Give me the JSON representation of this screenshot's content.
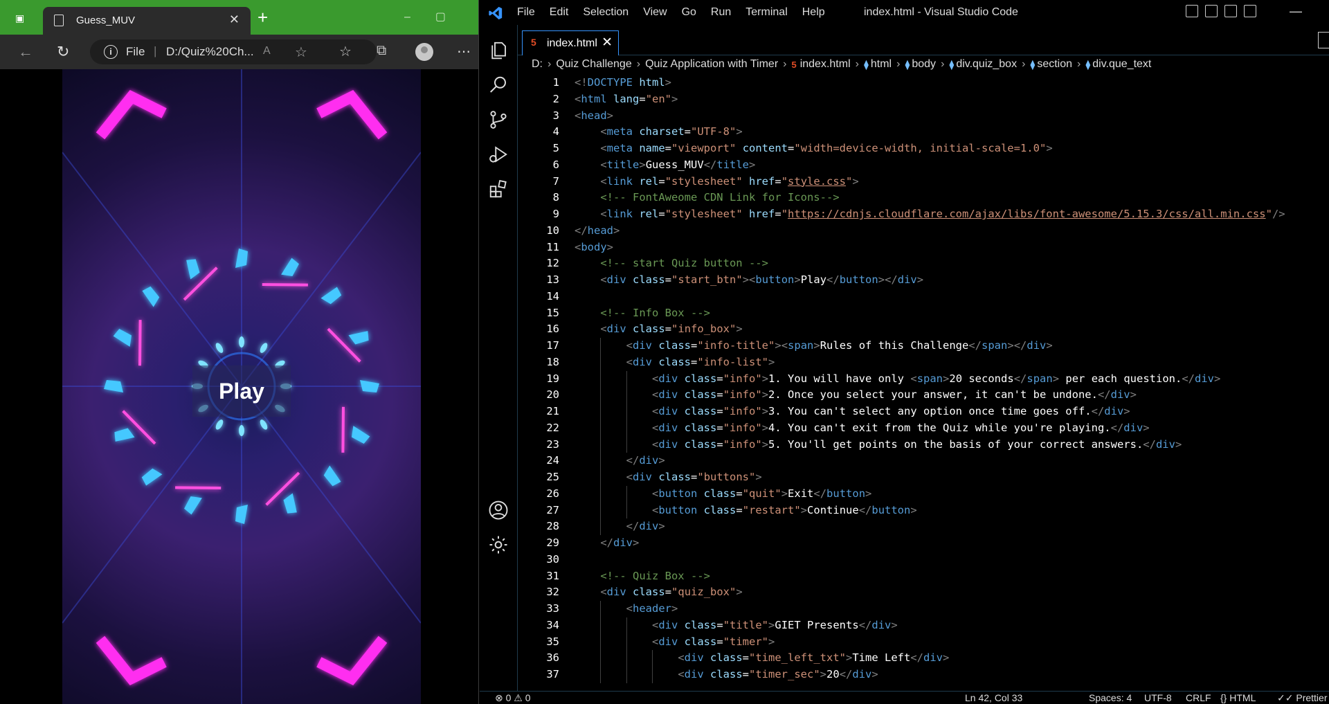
{
  "browser": {
    "tab_title": "Guess_MUV",
    "address_scheme": "File",
    "address_url": "D:/Quiz%20Ch...",
    "page": {
      "play_label": "Play"
    }
  },
  "vscode": {
    "menu": [
      "File",
      "Edit",
      "Selection",
      "View",
      "Go",
      "Run",
      "Terminal",
      "Help"
    ],
    "window_title": "index.html - Visual Studio Code",
    "tab_name": "index.html",
    "breadcrumb": [
      "D:",
      "Quiz Challenge",
      "Quiz Application with Timer",
      "index.html",
      "html",
      "body",
      "div.quiz_box",
      "section",
      "div.que_text"
    ],
    "line_numbers": [
      "1",
      "2",
      "3",
      "4",
      "5",
      "6",
      "7",
      "8",
      "9",
      "10",
      "11",
      "12",
      "13",
      "14",
      "15",
      "16",
      "17",
      "18",
      "19",
      "20",
      "21",
      "22",
      "23",
      "24",
      "25",
      "26",
      "27",
      "28",
      "29",
      "30",
      "31",
      "32",
      "33",
      "34",
      "35",
      "36",
      "37"
    ],
    "code_lines": [
      "<!DOCTYPE html>",
      "<html lang=\"en\">",
      "<head>",
      "    <meta charset=\"UTF-8\">",
      "    <meta name=\"viewport\" content=\"width=device-width, initial-scale=1.0\">",
      "    <title>Guess_MUV</title>",
      "    <link rel=\"stylesheet\" href=\"style.css\">",
      "    <!-- FontAweome CDN Link for Icons-->",
      "    <link rel=\"stylesheet\" href=\"https://cdnjs.cloudflare.com/ajax/libs/font-awesome/5.15.3/css/all.min.css\"/>",
      "</head>",
      "<body>",
      "    <!-- start Quiz button -->",
      "    <div class=\"start_btn\"><button>Play</button></div>",
      "",
      "    <!-- Info Box -->",
      "    <div class=\"info_box\">",
      "        <div class=\"info-title\"><span>Rules of this Challenge</span></div>",
      "        <div class=\"info-list\">",
      "            <div class=\"info\">1. You will have only <span>20 seconds</span> per each question.</div>",
      "            <div class=\"info\">2. Once you select your answer, it can't be undone.</div>",
      "            <div class=\"info\">3. You can't select any option once time goes off.</div>",
      "            <div class=\"info\">4. You can't exit from the Quiz while you're playing.</div>",
      "            <div class=\"info\">5. You'll get points on the basis of your correct answers.</div>",
      "        </div>",
      "        <div class=\"buttons\">",
      "            <button class=\"quit\">Exit</button>",
      "            <button class=\"restart\">Continue</button>",
      "        </div>",
      "    </div>",
      "",
      "    <!-- Quiz Box -->",
      "    <div class=\"quiz_box\">",
      "        <header>",
      "            <div class=\"title\">GIET Presents</div>",
      "            <div class=\"timer\">",
      "                <div class=\"time_left_txt\">Time Left</div>",
      "                <div class=\"timer_sec\">20</div>"
    ],
    "status": {
      "errors": "0",
      "warnings": "0",
      "position": "Ln 42, Col 33",
      "spaces": "Spaces: 4",
      "encoding": "UTF-8",
      "eol": "CRLF",
      "language": "HTML",
      "formatter": "Prettier"
    }
  }
}
